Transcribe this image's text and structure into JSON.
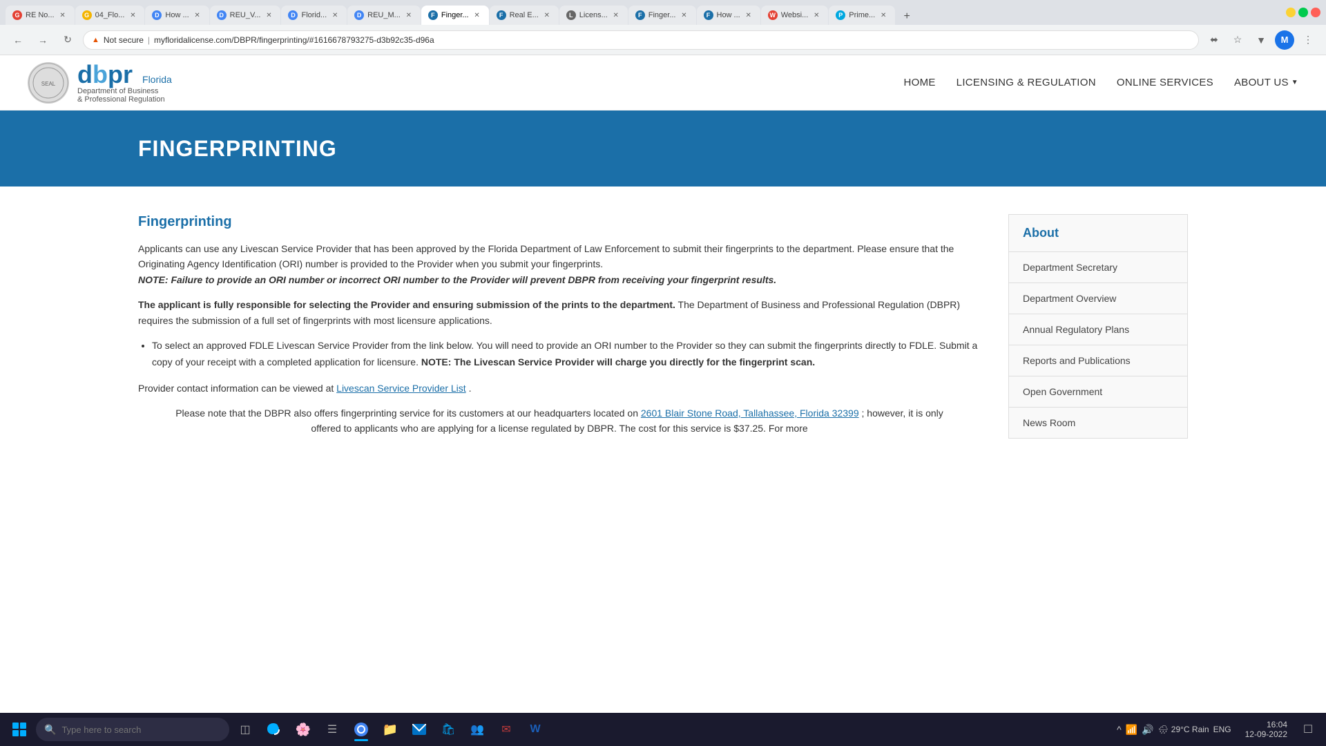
{
  "browser": {
    "tabs": [
      {
        "id": "tab1",
        "label": "RE No...",
        "favicon_color": "#e44134",
        "active": false,
        "icon": "G"
      },
      {
        "id": "tab2",
        "label": "04_Flo...",
        "favicon_color": "#f4b400",
        "active": false,
        "icon": "G"
      },
      {
        "id": "tab3",
        "label": "How ...",
        "favicon_color": "#4285f4",
        "active": false,
        "icon": "D"
      },
      {
        "id": "tab4",
        "label": "REU_V...",
        "favicon_color": "#4285f4",
        "active": false,
        "icon": "D"
      },
      {
        "id": "tab5",
        "label": "Florid...",
        "favicon_color": "#4285f4",
        "active": false,
        "icon": "D"
      },
      {
        "id": "tab6",
        "label": "REU_M...",
        "favicon_color": "#4285f4",
        "active": false,
        "icon": "D"
      },
      {
        "id": "tab7",
        "label": "Finger...",
        "favicon_color": "#1b6fa8",
        "active": true,
        "icon": "F"
      },
      {
        "id": "tab8",
        "label": "Real E...",
        "favicon_color": "#1b6fa8",
        "active": false,
        "icon": "F"
      },
      {
        "id": "tab9",
        "label": "Licens...",
        "favicon_color": "#666",
        "active": false,
        "icon": "L"
      },
      {
        "id": "tab10",
        "label": "Finger...",
        "favicon_color": "#1b6fa8",
        "active": false,
        "icon": "F"
      },
      {
        "id": "tab11",
        "label": "How ...",
        "favicon_color": "#1b6fa8",
        "active": false,
        "icon": "F"
      },
      {
        "id": "tab12",
        "label": "Websi...",
        "favicon_color": "#e44134",
        "active": false,
        "icon": "W"
      },
      {
        "id": "tab13",
        "label": "Prime...",
        "favicon_color": "#00a8e0",
        "active": false,
        "icon": "P"
      }
    ],
    "url": "myfloridalicense.com/DBPR/fingerprinting/#1616678793275-d3b92c35-d96a",
    "secure": false,
    "secure_label": "Not secure"
  },
  "site": {
    "logo_main": "dbpr",
    "logo_subtitle": "Department of Business\n& Professional Regulation",
    "nav_links": [
      {
        "label": "HOME",
        "id": "home"
      },
      {
        "label": "LICENSING & REGULATION",
        "id": "licensing"
      },
      {
        "label": "ONLINE SERVICES",
        "id": "online-services"
      },
      {
        "label": "ABOUT US",
        "id": "about-us",
        "has_dropdown": true
      }
    ],
    "hero_title": "FINGERPRINTING"
  },
  "content": {
    "section_title": "Fingerprinting",
    "paragraph1": "Applicants can use any Livescan Service Provider that has been approved by the Florida Department of Law Enforcement to submit their fingerprints to the department. Please ensure that the Originating Agency Identification (ORI) number is provided to the Provider when you submit your fingerprints.",
    "paragraph1_note": "NOTE: Failure to provide an ORI number or incorrect ORI number to the Provider will prevent DBPR from receiving your fingerprint results.",
    "paragraph2_strong": "The applicant is fully responsible for selecting the Provider and ensuring submission of the prints to the department.",
    "paragraph2_rest": " The Department of Business and Professional Regulation (DBPR) requires the submission of a full set of fingerprints with most licensure applications.",
    "bullet1_text": "To select an approved FDLE Livescan Service Provider from the link below.  You will need to provide an ORI number to the Provider so they can submit the fingerprints directly to FDLE.  Submit a copy of your receipt with a completed application for licensure. ",
    "bullet1_note": "NOTE: The Livescan Service Provider will charge you directly for the fingerprint scan.",
    "provider_text": "Provider contact information can be viewed at ",
    "provider_link": "Livescan Service Provider List",
    "provider_period": ".",
    "paragraph3_intro": "Please note that the DBPR also offers fingerprinting service for its customers at our headquarters located on ",
    "paragraph3_address": "2601 Blair Stone Road, Tallahassee, Florida 32399",
    "paragraph3_rest": "; however, it is only offered to applicants who are applying for a license regulated by DBPR. The cost for this service is $37.25. For more"
  },
  "sidebar": {
    "header": "About",
    "items": [
      {
        "label": "Department Secretary",
        "id": "dept-secretary"
      },
      {
        "label": "Department Overview",
        "id": "dept-overview"
      },
      {
        "label": "Annual Regulatory Plans",
        "id": "annual-plans"
      },
      {
        "label": "Reports and Publications",
        "id": "reports-pubs"
      },
      {
        "label": "Open Government",
        "id": "open-govt"
      },
      {
        "label": "News Room",
        "id": "news-room"
      }
    ]
  },
  "taskbar": {
    "search_placeholder": "Type here to search",
    "weather": "29°C  Rain",
    "time": "16:04",
    "date": "12-09-2022",
    "language": "ENG"
  }
}
